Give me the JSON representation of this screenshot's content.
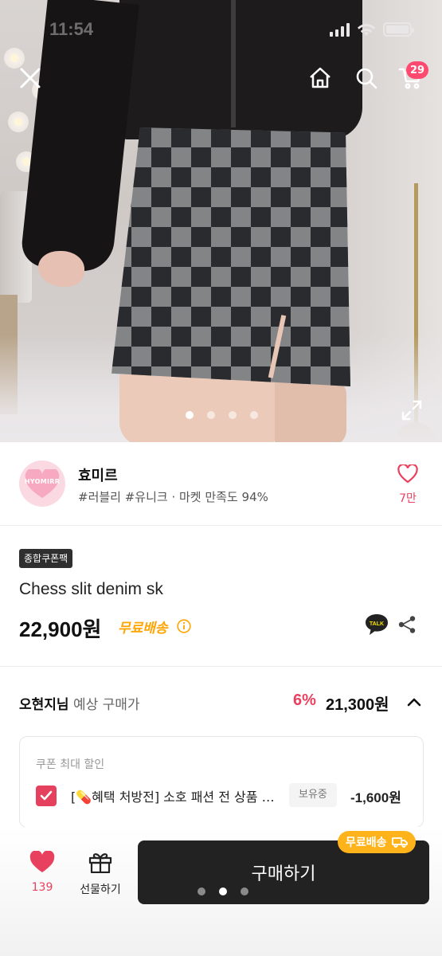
{
  "status_bar": {
    "time": "11:54"
  },
  "header": {
    "cart_count": "29"
  },
  "gallery": {
    "image_count": 4,
    "active_index": 1
  },
  "seller": {
    "logo_text": "HYOMIRR",
    "name": "효미르",
    "tags": "#러블리 #유니크 · 마켓 만족도 94%",
    "like_count": "7만"
  },
  "product": {
    "coupon_tag": "종합쿠폰팩",
    "name": "Chess slit denim sk",
    "price": "22,900원",
    "shipping": "무료배송",
    "talk_label": "TALK"
  },
  "estimate": {
    "user": "오현지님",
    "label": "예상 구매가",
    "discount_pct": "6%",
    "price": "21,300원"
  },
  "coupon": {
    "header": "쿠폰 최대 할인",
    "name": "[💊혜택 처방전] 소호 패션 전 상품 할인 쿠폰",
    "state": "보유중",
    "discount": "-1,600원"
  },
  "bottom_bar": {
    "wish_count": "139",
    "gift_label": "선물하기",
    "buy_label": "구매하기",
    "free_ship_badge": "무료배송",
    "page_count": 3,
    "page_active": 2
  },
  "colors": {
    "accent": "#e8415f",
    "badge": "#ff4a6f",
    "shipping": "#ffa400",
    "buy_button": "#222222"
  },
  "icons": [
    "close-icon",
    "home-icon",
    "search-icon",
    "cart-icon",
    "expand-icon",
    "heart-icon",
    "info-icon",
    "talk-icon",
    "share-icon",
    "chevron-up-icon",
    "checkbox-icon",
    "gift-icon",
    "truck-icon"
  ]
}
